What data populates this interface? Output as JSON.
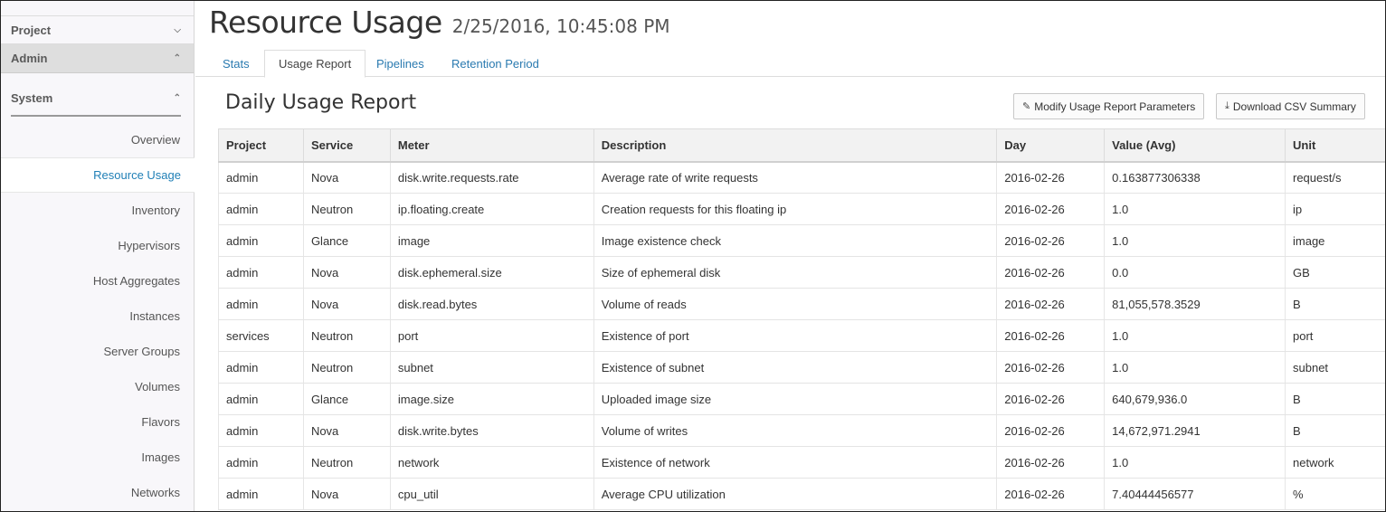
{
  "sidebar": {
    "project_label": "Project",
    "admin_label": "Admin",
    "system_label": "System",
    "items": [
      {
        "label": "Overview"
      },
      {
        "label": "Resource Usage"
      },
      {
        "label": "Inventory"
      },
      {
        "label": "Hypervisors"
      },
      {
        "label": "Host Aggregates"
      },
      {
        "label": "Instances"
      },
      {
        "label": "Server Groups"
      },
      {
        "label": "Volumes"
      },
      {
        "label": "Flavors"
      },
      {
        "label": "Images"
      },
      {
        "label": "Networks"
      }
    ]
  },
  "header": {
    "title": "Resource Usage",
    "timestamp": "2/25/2016, 10:45:08 PM"
  },
  "tabs": [
    {
      "label": "Stats"
    },
    {
      "label": "Usage Report"
    },
    {
      "label": "Pipelines"
    },
    {
      "label": "Retention Period"
    }
  ],
  "report": {
    "title": "Daily Usage Report",
    "modify_button": "Modify Usage Report Parameters",
    "download_button": "Download CSV Summary",
    "columns": [
      "Project",
      "Service",
      "Meter",
      "Description",
      "Day",
      "Value (Avg)",
      "Unit"
    ],
    "rows": [
      [
        "admin",
        "Nova",
        "disk.write.requests.rate",
        "Average rate of write requests",
        "2016-02-26",
        "0.163877306338",
        "request/s"
      ],
      [
        "admin",
        "Neutron",
        "ip.floating.create",
        "Creation requests for this floating ip",
        "2016-02-26",
        "1.0",
        "ip"
      ],
      [
        "admin",
        "Glance",
        "image",
        "Image existence check",
        "2016-02-26",
        "1.0",
        "image"
      ],
      [
        "admin",
        "Nova",
        "disk.ephemeral.size",
        "Size of ephemeral disk",
        "2016-02-26",
        "0.0",
        "GB"
      ],
      [
        "admin",
        "Nova",
        "disk.read.bytes",
        "Volume of reads",
        "2016-02-26",
        "81,055,578.3529",
        "B"
      ],
      [
        "services",
        "Neutron",
        "port",
        "Existence of port",
        "2016-02-26",
        "1.0",
        "port"
      ],
      [
        "admin",
        "Neutron",
        "subnet",
        "Existence of subnet",
        "2016-02-26",
        "1.0",
        "subnet"
      ],
      [
        "admin",
        "Glance",
        "image.size",
        "Uploaded image size",
        "2016-02-26",
        "640,679,936.0",
        "B"
      ],
      [
        "admin",
        "Nova",
        "disk.write.bytes",
        "Volume of writes",
        "2016-02-26",
        "14,672,971.2941",
        "B"
      ],
      [
        "admin",
        "Neutron",
        "network",
        "Existence of network",
        "2016-02-26",
        "1.0",
        "network"
      ],
      [
        "admin",
        "Nova",
        "cpu_util",
        "Average CPU utilization",
        "2016-02-26",
        "7.40444456577",
        "%"
      ]
    ]
  }
}
